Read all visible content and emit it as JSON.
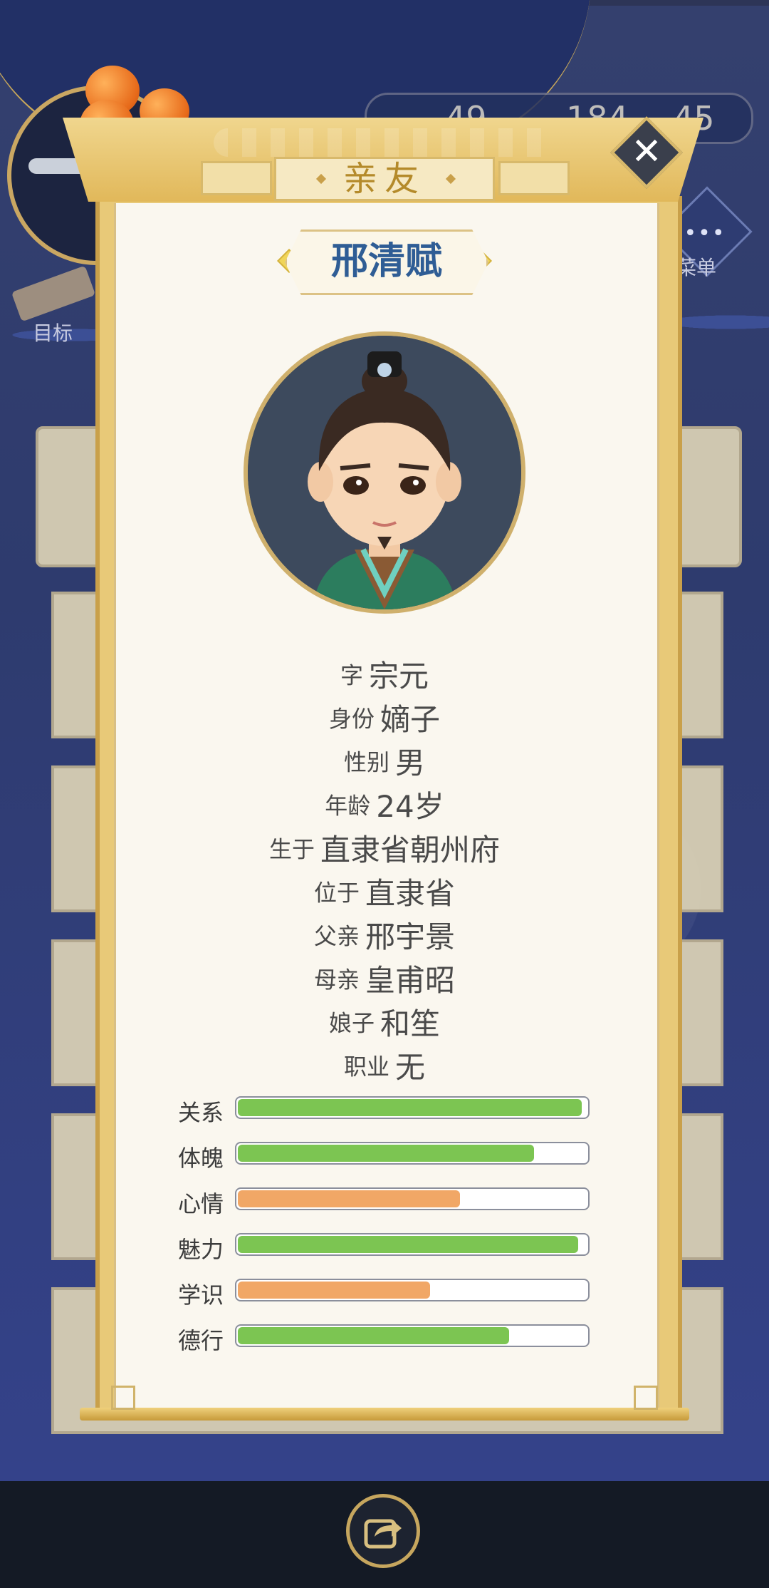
{
  "background": {
    "resources": [
      "49",
      "184",
      "45"
    ],
    "side_labels": {
      "goal": "目标",
      "menu": "菜单"
    }
  },
  "panel": {
    "title": "亲友",
    "close_symbol": "✕"
  },
  "profile": {
    "name": "邢清赋",
    "fields": [
      {
        "label": "字",
        "value": "宗元"
      },
      {
        "label": "身份",
        "value": "嫡子"
      },
      {
        "label": "性别",
        "value": "男"
      },
      {
        "label": "年龄",
        "value": "24岁"
      },
      {
        "label": "生于",
        "value": "直隶省朝州府"
      },
      {
        "label": "位于",
        "value": "直隶省"
      },
      {
        "label": "父亲",
        "value": "邢宇景"
      },
      {
        "label": "母亲",
        "value": "皇甫昭"
      },
      {
        "label": "娘子",
        "value": "和笙"
      },
      {
        "label": "职业",
        "value": "无"
      }
    ]
  },
  "stats": [
    {
      "label": "关系",
      "value": 0.985,
      "color": "#7cc552"
    },
    {
      "label": "体魄",
      "value": 0.85,
      "color": "#7cc552"
    },
    {
      "label": "心情",
      "value": 0.64,
      "color": "#f1a766"
    },
    {
      "label": "魅力",
      "value": 0.975,
      "color": "#7cc552"
    },
    {
      "label": "学识",
      "value": 0.555,
      "color": "#f1a766"
    },
    {
      "label": "德行",
      "value": 0.78,
      "color": "#7cc552"
    }
  ],
  "icons": {
    "close": "close-icon",
    "share": "share-icon"
  }
}
